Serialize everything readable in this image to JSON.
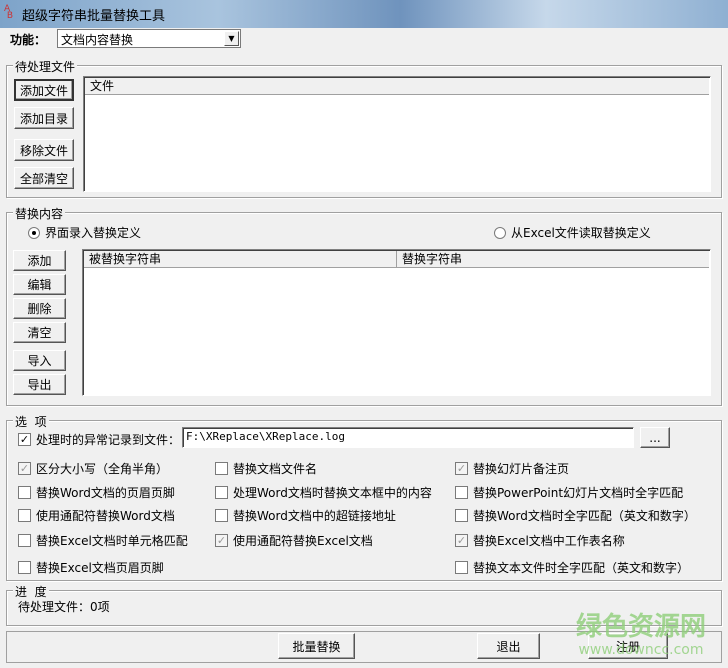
{
  "window": {
    "title": "超级字符串批量替换工具"
  },
  "function": {
    "label": "功能：",
    "value": "文档内容替换"
  },
  "files_group": {
    "title": "待处理文件",
    "buttons": [
      "添加文件",
      "添加目录",
      "移除文件",
      "全部清空"
    ],
    "column": "文件"
  },
  "replace_group": {
    "title": "替换内容",
    "radio_ui": "界面录入替换定义",
    "radio_excel": "从Excel文件读取替换定义",
    "radio_selected": "ui",
    "buttons": [
      "添加",
      "编辑",
      "删除",
      "清空",
      "导入",
      "导出"
    ],
    "columns": [
      "被替换字符串",
      "替换字符串"
    ]
  },
  "options_group": {
    "title": "选  项",
    "log_label": "处理时的异常记录到文件：",
    "log_checked": true,
    "log_path": "F:\\XReplace\\XReplace.log",
    "browse": "...",
    "options": [
      {
        "label": "区分大小写（全角半角）",
        "checked": true,
        "disabled": true
      },
      {
        "label": "替换文档文件名",
        "checked": false
      },
      {
        "label": "替换幻灯片备注页",
        "checked": true,
        "disabled": true
      },
      {
        "label": "替换Word文档的页眉页脚",
        "checked": false
      },
      {
        "label": "处理Word文档时替换文本框中的内容",
        "checked": false
      },
      {
        "label": "替换PowerPoint幻灯片文档时全字匹配",
        "checked": false
      },
      {
        "label": "使用通配符替换Word文档",
        "checked": false
      },
      {
        "label": "替换Word文档中的超链接地址",
        "checked": false
      },
      {
        "label": "替换Word文档时全字匹配（英文和数字）",
        "checked": false
      },
      {
        "label": "替换Excel文档时单元格匹配",
        "checked": false
      },
      {
        "label": "使用通配符替换Excel文档",
        "checked": true,
        "disabled": true
      },
      {
        "label": "替换Excel文档中工作表名称",
        "checked": true,
        "disabled": true
      },
      {
        "label": "替换Excel文档页眉页脚",
        "checked": false
      },
      {
        "label": "替换文本文件时全字匹配（英文和数字）",
        "checked": false
      }
    ]
  },
  "progress_group": {
    "title": "进  度",
    "status": "待处理文件：0项"
  },
  "footer": {
    "batch": "批量替换",
    "exit": "退出",
    "register": "注册"
  },
  "watermark": {
    "name": "绿色资源网",
    "url": "www.downcc.com"
  }
}
